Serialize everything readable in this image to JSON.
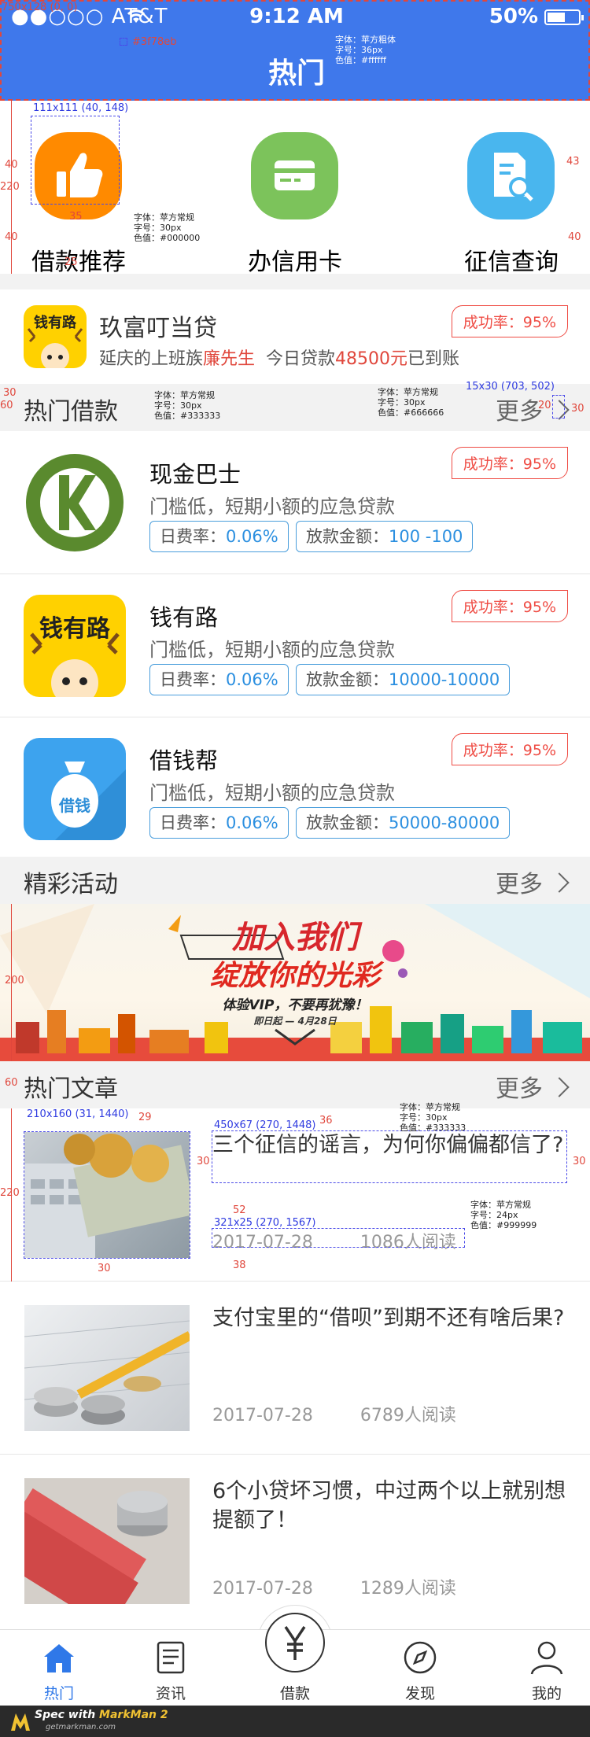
{
  "status_bar": {
    "carrier": "●●○○○ AT&T",
    "time": "9:12 AM",
    "battery": "50%"
  },
  "nav": {
    "title": "热门"
  },
  "annotations": {
    "canvas": "750x128 (0, 0)",
    "nav_color": "#3f78eb",
    "nav_font": "字体：苹方粗体\n字号：36px\n色值：#ffffff",
    "icon_box": "111x111 (40, 148)",
    "quick_label_font": "字体：苹方常规\n字号：30px\n色值：#000000",
    "sec_title_font": "字体：苹方常规\n字号：30px\n色值：#333333",
    "sec_more_font": "字体：苹方常规\n字号：30px\n色值：#666666",
    "more_box": "15x30 (703, 502)",
    "thumb_box": "210x160 (31, 1440)",
    "title_box": "450x67 (270, 1448)",
    "meta_box": "321x25 (270, 1567)",
    "article_title_font": "字体：苹方常规\n字号：30px\n色值：#333333",
    "article_meta_font": "字体：苹方常规\n字号：24px\n色值：#999999",
    "dims": [
      "40",
      "43",
      "220",
      "40",
      "35",
      "25",
      "40",
      "20",
      "30",
      "60",
      "20",
      "30",
      "200",
      "60",
      "29",
      "36",
      "30",
      "30",
      "220",
      "52",
      "30",
      "38"
    ]
  },
  "quick_entries": [
    {
      "label": "借款推荐",
      "icon": "thumbs-up-icon",
      "color": "#ff8a00"
    },
    {
      "label": "办信用卡",
      "icon": "credit-card-icon",
      "color": "#7cc35b"
    },
    {
      "label": "征信查询",
      "icon": "document-search-icon",
      "color": "#49b6ee"
    }
  ],
  "promo": {
    "name": "玖富叮当贷",
    "desc_prefix": "延庆的上班族",
    "desc_name": "廉先生",
    "desc_mid": "今日贷款",
    "desc_amount": "48500元",
    "desc_suffix": "已到账",
    "rate": "成功率：95%",
    "logo_text": "钱有路"
  },
  "hot_loans": {
    "title": "热门借款",
    "more": "更多",
    "items": [
      {
        "name": "现金巴士",
        "desc": "门槛低，短期小额的应急贷款",
        "rate_label": "日费率：",
        "rate_value": "0.06%",
        "amount_label": "放款金额：",
        "amount_value": "100 -100",
        "badge": "成功率：95%",
        "logo": "cash-bus-logo"
      },
      {
        "name": "钱有路",
        "desc": "门槛低，短期小额的应急贷款",
        "rate_label": "日费率：",
        "rate_value": "0.06%",
        "amount_label": "放款金额：",
        "amount_value": "10000-10000",
        "badge": "成功率：95%",
        "logo": "qianyoulu-logo",
        "logo_text": "钱有路"
      },
      {
        "name": "借钱帮",
        "desc": "门槛低，短期小额的应急贷款",
        "rate_label": "日费率：",
        "rate_value": "0.06%",
        "amount_label": "放款金额：",
        "amount_value": "50000-80000",
        "badge": "成功率：95%",
        "logo": "money-bag-logo",
        "logo_text": "借钱"
      }
    ]
  },
  "activities": {
    "title": "精彩活动",
    "more": "更多",
    "banner_line1": "加入我们",
    "banner_line2": "绽放你的光彩",
    "banner_line3": "体验VIP，不要再犹豫！",
    "banner_line4": "即日起 — 4月28日"
  },
  "articles": {
    "title": "热门文章",
    "more": "更多",
    "items": [
      {
        "title": "三个征信的谣言，为何你偏偏都信了?",
        "date": "2017-07-28",
        "reads": "1086人阅读"
      },
      {
        "title": "支付宝里的“借呗”到期不还有啥后果?",
        "date": "2017-07-28",
        "reads": "6789人阅读"
      },
      {
        "title": "6个小贷坏习惯，中过两个以上就别想提额了！",
        "date": "2017-07-28",
        "reads": "1289人阅读"
      }
    ]
  },
  "tabbar": [
    {
      "label": "热门",
      "icon": "home-icon",
      "active": true
    },
    {
      "label": "资讯",
      "icon": "news-icon",
      "active": false
    },
    {
      "label": "借款",
      "icon": "yen-icon",
      "active": false
    },
    {
      "label": "发现",
      "icon": "compass-icon",
      "active": false
    },
    {
      "label": "我的",
      "icon": "user-icon",
      "active": false
    }
  ],
  "footer": {
    "brand_prefix": "Spec with ",
    "brand_name": "MarkMan 2",
    "site": "getmarkman.com"
  },
  "colors": {
    "primary": "#3f78eb",
    "accent_red": "#ef4c44",
    "link_blue": "#2b8fe0",
    "tab_active": "#2f78e8"
  }
}
